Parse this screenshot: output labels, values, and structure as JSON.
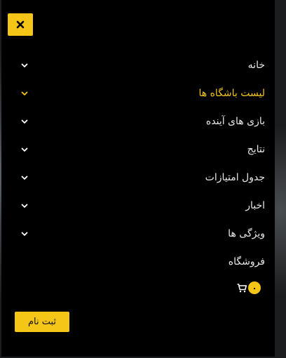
{
  "drawer": {
    "close_icon": "close-icon",
    "menu": [
      {
        "label": "خانه",
        "has_submenu": true,
        "active": false
      },
      {
        "label": "لیست باشگاه ها",
        "has_submenu": true,
        "active": true
      },
      {
        "label": "بازی های آینده",
        "has_submenu": true,
        "active": false
      },
      {
        "label": "نتایج",
        "has_submenu": true,
        "active": false
      },
      {
        "label": "جدول امتیازات",
        "has_submenu": true,
        "active": false
      },
      {
        "label": "اخبار",
        "has_submenu": true,
        "active": false
      },
      {
        "label": "ویژگی ها",
        "has_submenu": true,
        "active": false
      },
      {
        "label": "فروشگاه",
        "has_submenu": false,
        "active": false
      }
    ],
    "cart": {
      "count": "۰",
      "icon": "shopping-cart-icon"
    },
    "signup_label": "ثبت نام"
  },
  "colors": {
    "accent": "#f5c518",
    "background": "#000000",
    "text": "#e9e9e9"
  }
}
